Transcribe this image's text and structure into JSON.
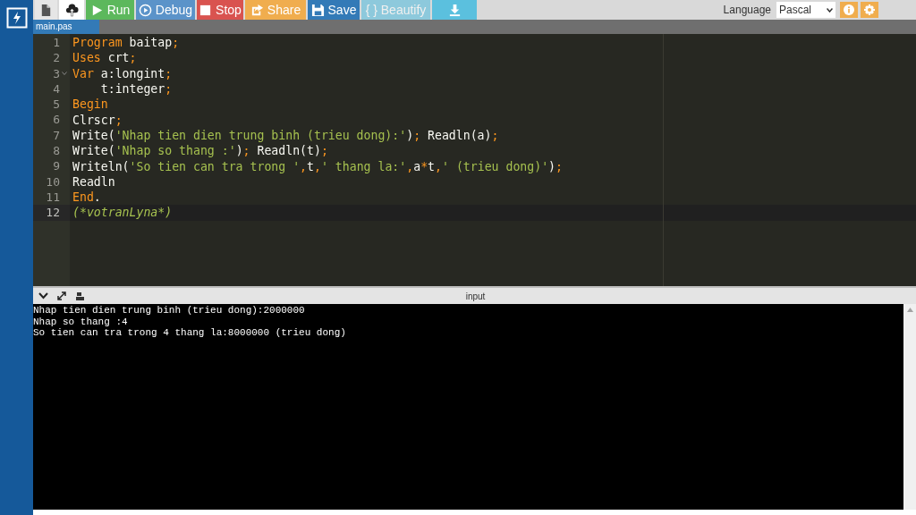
{
  "toolbar": {
    "buttons": [
      {
        "kind": "new-file",
        "disabled": false
      },
      {
        "kind": "upload",
        "disabled": false
      },
      {
        "kind": "run",
        "label": "Run",
        "disabled": false
      },
      {
        "kind": "debug",
        "label": "Debug",
        "disabled": false
      },
      {
        "kind": "stop",
        "label": "Stop",
        "disabled": false
      },
      {
        "kind": "share",
        "label": "Share",
        "disabled": false
      },
      {
        "kind": "save",
        "label": "Save",
        "disabled": false
      },
      {
        "kind": "beautify",
        "label": "{ } Beautify",
        "disabled": true
      },
      {
        "kind": "download",
        "disabled": false
      }
    ],
    "language_label": "Language",
    "language": "Pascal"
  },
  "tabs": [
    {
      "label": "main.pas",
      "selected": true
    }
  ],
  "editor": {
    "lines": [
      {
        "number": "1",
        "active": false,
        "fold": false,
        "tokens": [
          {
            "kind": "keyword",
            "text": "Program "
          },
          {
            "kind": "ident",
            "text": "baitap"
          },
          {
            "kind": "keyword",
            "text": ";"
          }
        ]
      },
      {
        "number": "2",
        "active": false,
        "fold": false,
        "tokens": [
          {
            "kind": "keyword",
            "text": "Uses "
          },
          {
            "kind": "ident",
            "text": "crt"
          },
          {
            "kind": "keyword",
            "text": ";"
          }
        ]
      },
      {
        "number": "3",
        "active": false,
        "fold": true,
        "tokens": [
          {
            "kind": "keyword",
            "text": "Var "
          },
          {
            "kind": "ident",
            "text": "a:longint"
          },
          {
            "kind": "keyword",
            "text": ";"
          }
        ]
      },
      {
        "number": "4",
        "active": false,
        "fold": false,
        "tokens": [
          {
            "kind": "ident",
            "text": "    t:integer"
          },
          {
            "kind": "keyword",
            "text": ";"
          }
        ]
      },
      {
        "number": "5",
        "active": false,
        "fold": false,
        "tokens": [
          {
            "kind": "keyword",
            "text": "Begin"
          }
        ]
      },
      {
        "number": "6",
        "active": false,
        "fold": false,
        "tokens": [
          {
            "kind": "ident",
            "text": "Clrscr"
          },
          {
            "kind": "keyword",
            "text": ";"
          }
        ]
      },
      {
        "number": "7",
        "active": false,
        "fold": false,
        "tokens": [
          {
            "kind": "ident",
            "text": "Write("
          },
          {
            "kind": "string",
            "text": "'Nhap tien dien trung binh (trieu dong):'"
          },
          {
            "kind": "ident",
            "text": ")"
          },
          {
            "kind": "keyword",
            "text": "; "
          },
          {
            "kind": "ident",
            "text": "Readln(a)"
          },
          {
            "kind": "keyword",
            "text": ";"
          }
        ]
      },
      {
        "number": "8",
        "active": false,
        "fold": false,
        "tokens": [
          {
            "kind": "ident",
            "text": "Write("
          },
          {
            "kind": "string",
            "text": "'Nhap so thang :'"
          },
          {
            "kind": "ident",
            "text": ")"
          },
          {
            "kind": "keyword",
            "text": "; "
          },
          {
            "kind": "ident",
            "text": "Readln(t)"
          },
          {
            "kind": "keyword",
            "text": ";"
          }
        ]
      },
      {
        "number": "9",
        "active": false,
        "fold": false,
        "tokens": [
          {
            "kind": "ident",
            "text": "Writeln("
          },
          {
            "kind": "string",
            "text": "'So tien can tra trong '"
          },
          {
            "kind": "keyword",
            "text": ","
          },
          {
            "kind": "ident",
            "text": "t"
          },
          {
            "kind": "keyword",
            "text": ","
          },
          {
            "kind": "string",
            "text": "' thang la:'"
          },
          {
            "kind": "keyword",
            "text": ","
          },
          {
            "kind": "ident",
            "text": "a"
          },
          {
            "kind": "keyword",
            "text": "*"
          },
          {
            "kind": "ident",
            "text": "t"
          },
          {
            "kind": "keyword",
            "text": ","
          },
          {
            "kind": "string",
            "text": "' (trieu dong)'"
          },
          {
            "kind": "ident",
            "text": ")"
          },
          {
            "kind": "keyword",
            "text": ";"
          }
        ]
      },
      {
        "number": "10",
        "active": false,
        "fold": false,
        "tokens": [
          {
            "kind": "ident",
            "text": "Readln"
          }
        ]
      },
      {
        "number": "11",
        "active": false,
        "fold": false,
        "tokens": [
          {
            "kind": "keyword",
            "text": "End"
          },
          {
            "kind": "ident",
            "text": "."
          }
        ]
      },
      {
        "number": "12",
        "active": true,
        "fold": false,
        "tokens": [
          {
            "kind": "comment",
            "text": "(*votranLyna*)"
          }
        ]
      }
    ]
  },
  "console": {
    "title": "input",
    "lines": [
      "Nhap tien dien trung binh (trieu dong):2000000",
      "Nhap so thang :4",
      "So tien can tra trong 4 thang la:8000000 (trieu dong)"
    ]
  }
}
